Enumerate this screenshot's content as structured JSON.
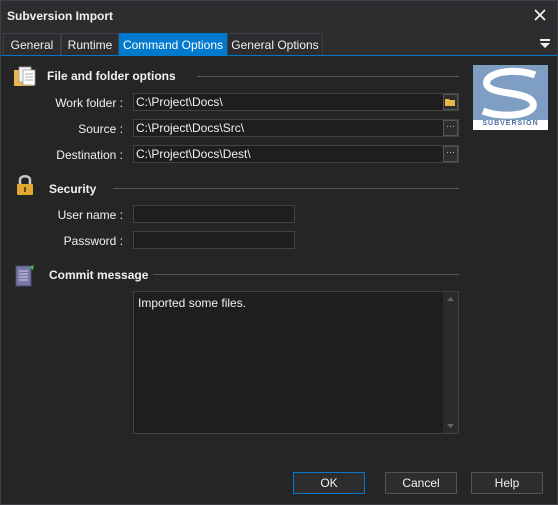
{
  "window": {
    "title": "Subversion Import"
  },
  "tabs": [
    {
      "label": "General"
    },
    {
      "label": "Runtime"
    },
    {
      "label": "Command Options",
      "active": true
    },
    {
      "label": "General Options"
    }
  ],
  "sections": {
    "files": {
      "title": "File and folder options",
      "work_folder": {
        "label": "Work folder :",
        "value": "C:\\Project\\Docs\\"
      },
      "source": {
        "label": "Source :",
        "value": "C:\\Project\\Docs\\Src\\"
      },
      "destination": {
        "label": "Destination :",
        "value": "C:\\Project\\Docs\\Dest\\"
      }
    },
    "security": {
      "title": "Security",
      "username": {
        "label": "User name :",
        "value": ""
      },
      "password": {
        "label": "Password :",
        "value": ""
      }
    },
    "commit": {
      "title": "Commit message",
      "message": "Imported some files."
    }
  },
  "logo": {
    "text": "SUBVERSION"
  },
  "buttons": {
    "ok": "OK",
    "cancel": "Cancel",
    "help": "Help"
  },
  "colors": {
    "accent": "#007acc",
    "background": "#252526",
    "field": "#1e1e1e"
  }
}
